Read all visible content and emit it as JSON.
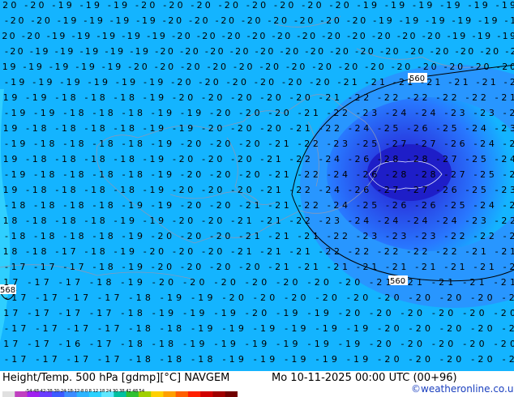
{
  "footer": {
    "title": "Height/Temp. 500 hPa [gdmp][°C] NAVGEM",
    "date": "Mo 10-11-2025 00:00 UTC (00+96)",
    "credit": "©weatheronline.co.uk"
  },
  "colorbar": {
    "ticks": "-54-48-42-38-30-24-18-12-8  0  8  12 18 24 30 38 42 48 54",
    "colors": [
      "#e0e0e0",
      "#c040c0",
      "#a020f0",
      "#6a3cff",
      "#3c5aff",
      "#3c8cff",
      "#2cb4ff",
      "#2cd2ff",
      "#60e8ff",
      "#00c0a0",
      "#30c030",
      "#a0d000",
      "#ffd000",
      "#ffa000",
      "#ff6000",
      "#ff2000",
      "#d00000",
      "#a00000",
      "#700000"
    ]
  },
  "map": {
    "background_color": "#14b4ff",
    "height_contour_labels": [
      "560",
      "560",
      "568"
    ],
    "temperature_labels": [
      {
        "rows": [
          "-20 -20 -19 -19 -19 -20 -20 -20 -20 -20 -20 -20 -20 -19 -19 -19 -19 -19 -19",
          "-20 -20 -19 -19 -19 -19 -20 -20 -20 -20 -20 -20 -20 -20 -19 -19 -19 -19 -19 -19",
          "-20 -20 -19 -19 -19 -19 -19 -20 -20 -20 -20 -20 -20 -20 -20 -20 -20 -20 -19 -19 -19",
          "-20 -19 -19 -19 -19 -19 -20 -20 -20 -20 -20 -20 -20 -20 -20 -20 -20 -20 -20 -20 -20",
          "-19 -19 -19 -19 -19 -20 -20 -20 -20 -20 -20 -20 -20 -20 -20 -20 -20 -20 -20 -20",
          "-19 -19 -19 -19 -19 -19 -20 -20 -20 -20 -20 -20 -21 -21 -21 -21 -21 -21 -21",
          "-19 -19 -18 -18 -18 -19 -20 -20 -20 -20 -20 -21 -22 -22 -22 -22 -22 -21",
          "-19 -19 -18 -18 -18 -19 -19 -20 -20 -20 -21 -22 -23 -24 -24 -23 -23 -22",
          "-19 -18 -18 -18 -18 -19 -19 -20 -20 -20 -21 -22 -24 -25 -26 -25 -24 -23",
          "-19 -18 -18 -18 -18 -19 -20 -20 -20 -21 -22 -23 -25 -27 -27 -26 -24 -23",
          "-19 -18 -18 -18 -18 -19 -20 -20 -20 -21 -22 -24 -26 -28 -28 -27 -25 -24",
          "-19 -18 -18 -18 -18 -19 -20 -20 -20 -21 -22 -24 -26 -28 -28 -27 -25 -24",
          "-19 -18 -18 -18 -18 -19 -20 -20 -20 -21 -22 -24 -26 -27 -27 -26 -25 -23",
          "-18 -18 -18 -18 -19 -19 -20 -20 -21 -21 -22 -24 -25 -26 -26 -25 -24 -23",
          "-18 -18 -18 -18 -19 -19 -20 -20 -21 -21 -22 -23 -24 -24 -24 -24 -23 -22",
          "-18 -18 -18 -18 -19 -20 -20 -20 -21 -21 -21 -22 -23 -23 -23 -22 -22 -22",
          "-18 -18 -17 -18 -19 -20 -20 -20 -21 -21 -21 -22 -22 -22 -22 -22 -21 -21",
          "-17 -17 -17 -18 -19 -20 -20 -20 -20 -21 -21 -21 -21 -21 -21 -21 -21 -21",
          "-17 -17 -17 -18 -19 -20 -20 -20 -20 -20 -20 -20 -21 -21 -21 -21 -21",
          "-17 -17 -17 -17 -18 -19 -19 -20 -20 -20 -20 -20 -20 -20 -20 -20 -20",
          "-17 -17 -17 -17 -18 -19 -19 -19 -20 -19 -19 -20 -20 -20 -20 -20 -20",
          "-17 -17 -17 -17 -18 -18 -19 -19 -19 -19 -19 -19 -20 -20 -20 -20 -20",
          "-17 -17 -16 -17 -18 -18 -19 -19 -19 -19 -19 -19 -20 -20 -20 -20 -20",
          "-17 -17 -17 -17 -18 -18 -18 -19 -19 -19 -19 -19 -20 -20 -20 -20 -20"
        ]
      }
    ]
  }
}
